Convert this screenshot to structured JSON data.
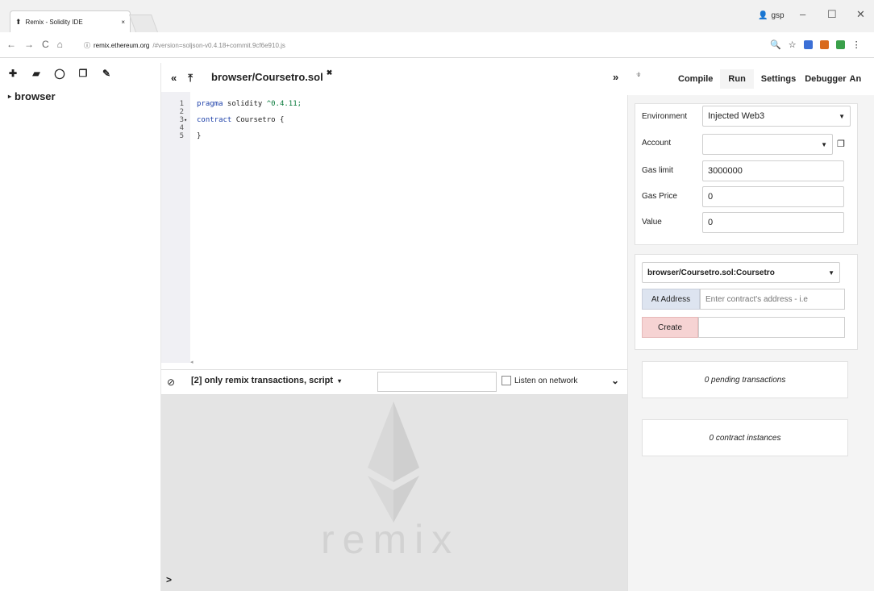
{
  "browser": {
    "tab_title": "Remix - Solidity IDE",
    "tab_close": "×",
    "window_user": "gsp",
    "window_controls": {
      "minimize": "–",
      "maximize": "☐",
      "close": "✕"
    },
    "url_host": "remix.ethereum.org",
    "url_path": "/#version=soljson-v0.4.18+commit.9cf6e910.js",
    "icons": [
      "back-icon",
      "forward-icon",
      "reload-icon",
      "home-icon",
      "info-icon",
      "zoom-icon",
      "star-icon"
    ]
  },
  "explorer": {
    "tools": [
      "new-file-icon",
      "open-folder-icon",
      "github-icon",
      "copy-icon",
      "connect-icon"
    ],
    "folder": "browser"
  },
  "editor": {
    "file_tab": "browser/Coursetro.sol",
    "close_glyph": "✖",
    "lines": [
      {
        "num": "1",
        "fold": "",
        "parts": [
          {
            "cls": "kw",
            "text": "pragma"
          },
          {
            "cls": "",
            "text": " solidity "
          },
          {
            "cls": "str",
            "text": "^0.4.11;"
          }
        ]
      },
      {
        "num": "2",
        "fold": "",
        "parts": []
      },
      {
        "num": "3",
        "fold": "▾",
        "parts": [
          {
            "cls": "kw",
            "text": "contract"
          },
          {
            "cls": "",
            "text": " Coursetro {"
          }
        ]
      },
      {
        "num": "4",
        "fold": "",
        "parts": []
      },
      {
        "num": "5",
        "fold": "",
        "parts": [
          {
            "cls": "",
            "text": "}"
          }
        ]
      }
    ]
  },
  "terminal": {
    "filter": "[2] only remix transactions, script",
    "listen_label": "Listen on network",
    "watermark": "remix",
    "prompt": ">"
  },
  "right": {
    "tabs": [
      "Compile",
      "Run",
      "Settings",
      "Debugger",
      "An"
    ],
    "active_tab": "Run",
    "environment_label": "Environment",
    "environment_value": "Injected Web3",
    "account_label": "Account",
    "account_value": "",
    "gas_limit_label": "Gas limit",
    "gas_limit_value": "3000000",
    "gas_price_label": "Gas Price",
    "gas_price_value": "0",
    "value_label": "Value",
    "value_value": "0",
    "contract_select": "browser/Coursetro.sol:Coursetro",
    "at_address_button": "At Address",
    "at_address_placeholder": "Enter contract's address - i.e",
    "create_button": "Create",
    "pending": "0 pending transactions",
    "instances": "0 contract instances"
  },
  "colors": {
    "create_bg": "#f6d3d3",
    "at_address_bg": "#dde4f0",
    "gutter_bg": "#f0f0f4",
    "terminal_bg": "#e4e4e4"
  }
}
